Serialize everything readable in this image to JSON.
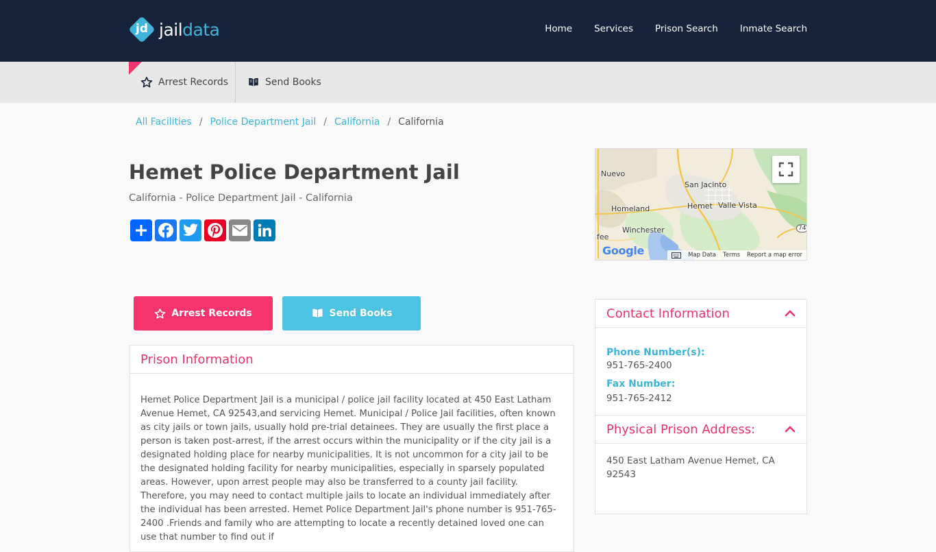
{
  "brand": {
    "mark": "jd",
    "name_a": "jail",
    "name_b": "data"
  },
  "nav": {
    "items": [
      "Home",
      "Services",
      "Prison Search",
      "Inmate Search"
    ]
  },
  "subnav": {
    "arrest_label": "Arrest Records",
    "books_label": "Send Books"
  },
  "breadcrumb": {
    "items": [
      "All Facilities",
      "Police Department Jail",
      "California"
    ],
    "current": "California",
    "separator": "/"
  },
  "page": {
    "title": "Hemet Police Department Jail",
    "subtitle": "California - Police Department Jail - California"
  },
  "share": {
    "buttons": [
      {
        "name": "share-icon",
        "color": "#0166ff"
      },
      {
        "name": "facebook-icon",
        "color": "#1877f2"
      },
      {
        "name": "twitter-icon",
        "color": "#1d9bf0"
      },
      {
        "name": "pinterest-icon",
        "color": "#e60023"
      },
      {
        "name": "email-icon",
        "color": "#888888"
      },
      {
        "name": "linkedin-icon",
        "color": "#007bb5"
      }
    ]
  },
  "map": {
    "labels": [
      "Nuevo",
      "San Jacinto",
      "Homeland",
      "Hemet",
      "Valle Vista",
      "Winchester",
      "fee",
      "74"
    ],
    "logo": "Google",
    "footer": [
      "Map Data",
      "Terms",
      "Report a map error"
    ]
  },
  "actions": {
    "arrest_label": "Arrest Records",
    "books_label": "Send Books"
  },
  "prison_info": {
    "heading": "Prison Information",
    "body": "Hemet Police Department Jail is a municipal / police jail facility located at 450 East Latham Avenue Hemet, CA 92543,and servicing Hemet. Municipal / Police Jail facilities, often known as city jails or town jails, usually hold pre-trial detainees. They are usually the first place a person is taken post-arrest, if the arrest occurs within the municipality or if the city jail is a designated holding place for nearby municipalities. It is not uncommon for a city jail to be the designated holding facility for nearby municipalities, especially in sparsely populated areas. However, upon arrest people may also be transferred to a county jail facility. Therefore, you may need to contact multiple jails to locate an individual immediately after the individual has been arrested. Hemet Police Department Jail's phone number is 951-765-2400 .Friends and family who are attempting to locate a recently detained loved one can use that number to find out if"
  },
  "contact": {
    "heading": "Contact Information",
    "phone_label": "Phone Number(s):",
    "phone": "951-765-2400",
    "fax_label": "Fax Number:",
    "fax": "951-765-2412"
  },
  "address": {
    "heading": "Physical Prison Address:",
    "line1": "450 East Latham Avenue Hemet, CA",
    "line2": "92543"
  },
  "colors": {
    "nav_bg": "#17233b",
    "accent_pink": "#f5346d",
    "accent_blue": "#40b4d8"
  }
}
